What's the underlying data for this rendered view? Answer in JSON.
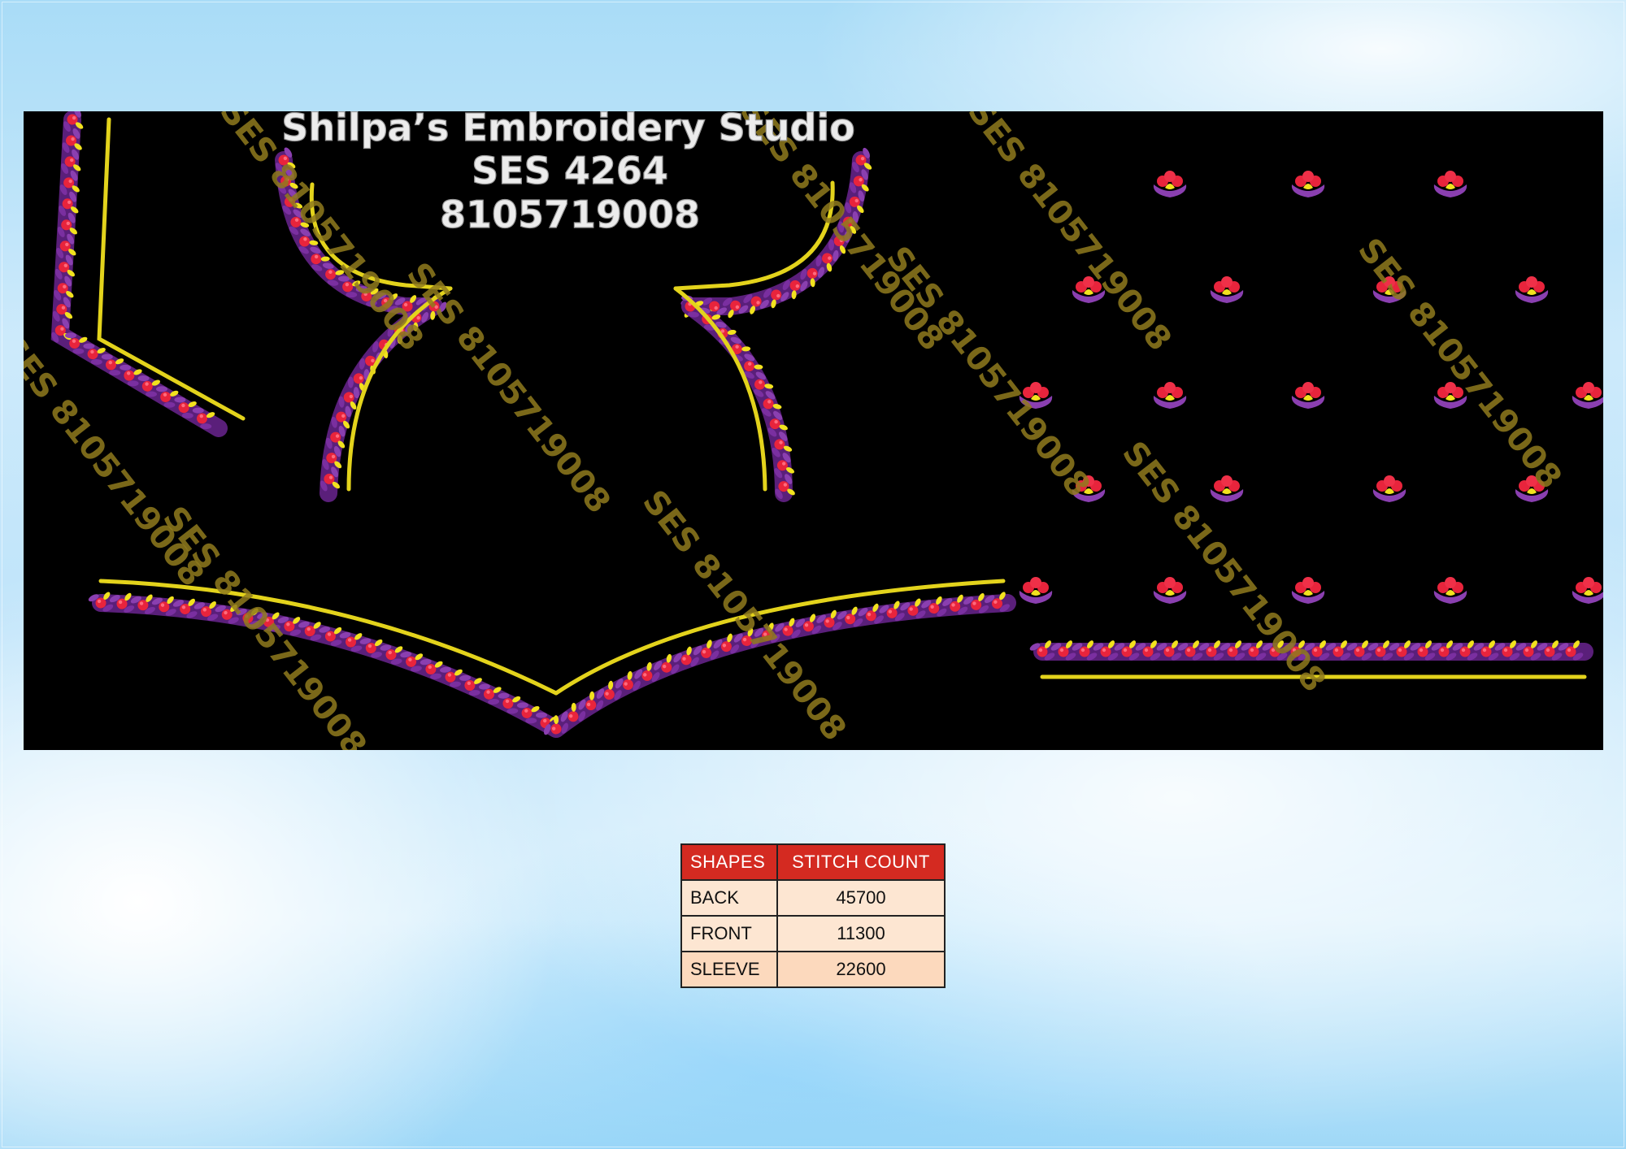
{
  "studio": {
    "name": "Shilpa’s  Embroidery  Studio",
    "design_code": "SES  4264",
    "phone": "8105719008"
  },
  "watermark_text": "SES 8105719008",
  "table": {
    "headers": [
      "SHAPES",
      "STITCH COUNT"
    ],
    "rows": [
      {
        "shape": "BACK",
        "count": "45700"
      },
      {
        "shape": "FRONT",
        "count": "11300"
      },
      {
        "shape": "SLEEVE",
        "count": "22600"
      }
    ]
  },
  "colors": {
    "background": "#000000",
    "outline": "#e3d31c",
    "flower_red": "#e8243c",
    "leaf_purple": "#8a3fb0",
    "paisley_yellow": "#f2e21e",
    "table_header": "#d42a21",
    "table_cell": "#fde6d2"
  }
}
